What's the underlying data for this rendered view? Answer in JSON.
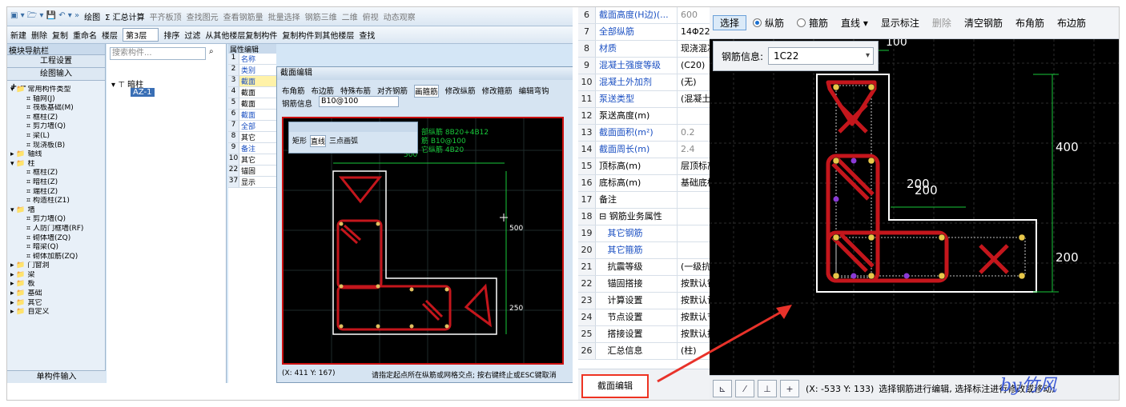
{
  "left": {
    "toolbar1": [
      "绘图",
      "Σ 汇总计算",
      "平齐板顶",
      "查找图元",
      "查看钢筋量",
      "批量选择",
      "钢筋三维",
      "二维",
      "俯视",
      "动态观察"
    ],
    "toolbar2": [
      "新建",
      "删除",
      "复制",
      "重命名",
      "楼层",
      "第3层",
      "排序",
      "过滤",
      "从其他楼层复制构件",
      "复制构件到其他楼层",
      "查找"
    ],
    "nav_title": "模块导航栏",
    "nav_buttons": [
      "工程设置",
      "绘图输入"
    ],
    "tree": [
      "常用构件类型",
      "轴网(J)",
      "筏板基础(M)",
      "框柱(Z)",
      "剪力墙(Q)",
      "梁(L)",
      "现浇板(B)",
      "轴线",
      "柱",
      "框柱(Z)",
      "暗柱(Z)",
      "端柱(Z)",
      "构造柱(Z1)",
      "墙",
      "剪力墙(Q)",
      "人防门框墙(RF)",
      "砌体墙(ZQ)",
      "暗梁(Q)",
      "砌体加筋(ZQ)",
      "门窗洞",
      "梁",
      "板",
      "基础",
      "其它",
      "自定义"
    ],
    "nav_footer": "单构件输入",
    "search_placeholder": "搜索构件...",
    "component_root": "暗柱",
    "component_item": "AZ-1",
    "props_tab": "属性编辑",
    "props_rows": [
      [
        "1",
        "名称"
      ],
      [
        "2",
        "类别"
      ],
      [
        "3",
        "截面"
      ],
      [
        "4",
        "截面"
      ],
      [
        "5",
        "截面"
      ],
      [
        "6",
        "截面"
      ],
      [
        "7",
        "全部"
      ],
      [
        "8",
        "其它"
      ],
      [
        "9",
        "备注"
      ],
      [
        "10",
        "其它"
      ],
      [
        "22",
        "锚固"
      ],
      [
        "37",
        "显示"
      ]
    ],
    "dialog_title": "截面编辑",
    "dialog_tabs": [
      "布角筋",
      "布边筋",
      "特殊布筋",
      "对齐钢筋",
      "画箍筋",
      "修改纵筋",
      "修改箍筋",
      "编辑弯钩"
    ],
    "rebar_info_label": "钢筋信息",
    "rebar_info_value": "B10@100",
    "mini_toolbar": [
      "矩形",
      "直线",
      "三点画弧"
    ],
    "annotations": [
      "部纵筋 8B20+4B12",
      "筋 B10@100",
      "它纵筋 4B20"
    ],
    "dims": [
      "500",
      "250",
      "500"
    ],
    "status_coords": "(X: 411 Y: 167)",
    "status_msg": "请指定起点所在纵筋或网格交点; 按右键终止或ESC键取消"
  },
  "right_props": {
    "rows": [
      {
        "n": "6",
        "k": "截面高度(H边)(...",
        "v": "600",
        "blue": true,
        "grey": true
      },
      {
        "n": "7",
        "k": "全部纵筋",
        "v": "14Φ22",
        "blue": true
      },
      {
        "n": "8",
        "k": "材质",
        "v": "现浇混凝",
        "blue": true
      },
      {
        "n": "9",
        "k": "混凝土强度等级",
        "v": "(C20)",
        "blue": true
      },
      {
        "n": "10",
        "k": "混凝土外加剂",
        "v": "(无)",
        "blue": true
      },
      {
        "n": "11",
        "k": "泵送类型",
        "v": "(混凝土",
        "blue": true
      },
      {
        "n": "12",
        "k": "泵送高度(m)",
        "v": "",
        "blue": false
      },
      {
        "n": "13",
        "k": "截面面积(m²)",
        "v": "0.2",
        "blue": true,
        "grey": true
      },
      {
        "n": "14",
        "k": "截面周长(m)",
        "v": "2.4",
        "blue": true,
        "grey": true
      },
      {
        "n": "15",
        "k": "顶标高(m)",
        "v": "层顶标高",
        "blue": false
      },
      {
        "n": "16",
        "k": "底标高(m)",
        "v": "基础底标",
        "blue": false
      },
      {
        "n": "17",
        "k": "备注",
        "v": "",
        "blue": false
      },
      {
        "n": "18",
        "k": "⊟ 钢筋业务属性",
        "v": "",
        "blue": false
      },
      {
        "n": "19",
        "k": "   其它钢筋",
        "v": "",
        "blue": true
      },
      {
        "n": "20",
        "k": "   其它箍筋",
        "v": "",
        "blue": true
      },
      {
        "n": "21",
        "k": "   抗震等级",
        "v": "(一级抗",
        "blue": false
      },
      {
        "n": "22",
        "k": "   锚固搭接",
        "v": "按默认锚",
        "blue": false
      },
      {
        "n": "23",
        "k": "   计算设置",
        "v": "按默认计",
        "blue": false
      },
      {
        "n": "24",
        "k": "   节点设置",
        "v": "按默认节",
        "blue": false
      },
      {
        "n": "25",
        "k": "   搭接设置",
        "v": "按默认搭",
        "blue": false
      },
      {
        "n": "26",
        "k": "   汇总信息",
        "v": "(柱)",
        "blue": false
      }
    ],
    "section_edit_button": "截面编辑"
  },
  "right_edit": {
    "toolbar": {
      "select": "选择",
      "longitudinal": "纵筋",
      "stirrup": "箍筋",
      "line": "直线",
      "show_marks": "显示标注",
      "delete": "删除",
      "clear": "清空钢筋",
      "corner": "布角筋",
      "edge": "布边筋"
    },
    "rebar_info_label": "钢筋信息:",
    "rebar_info_value": "1C22",
    "dims": [
      "100",
      "400",
      "200",
      "200",
      "200"
    ],
    "status_coords": "(X: -533 Y: 133)",
    "status_msg": "选择钢筋进行编辑, 选择标注进行修改或移动;"
  },
  "signature": "by竹风",
  "colors": {
    "rebar": "#c4161c",
    "dim": "#18c83a",
    "outline": "#ffffff",
    "accent": "#e8322a"
  }
}
